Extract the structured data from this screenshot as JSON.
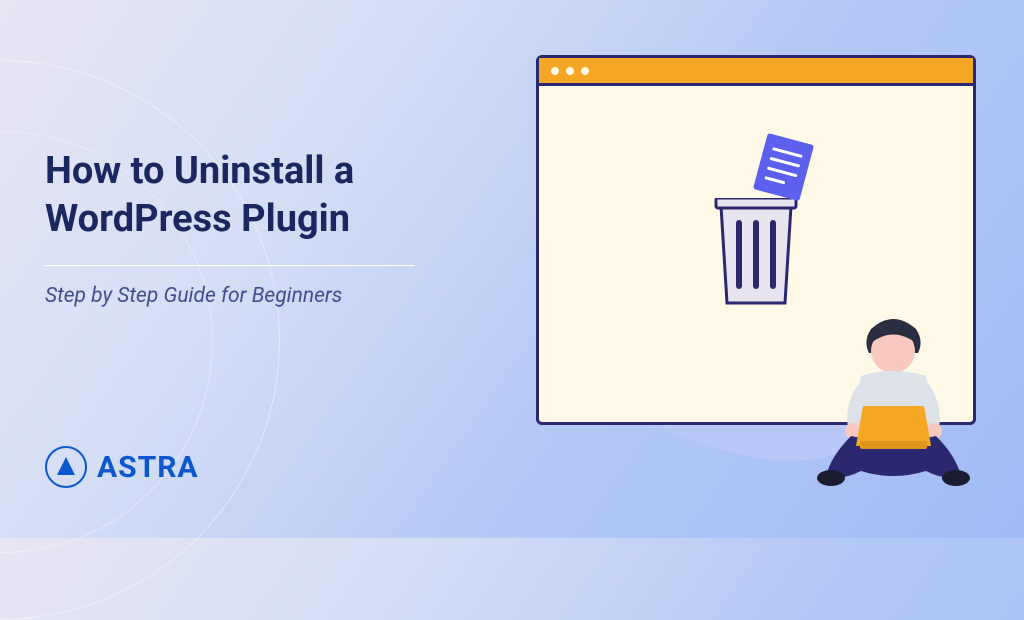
{
  "title": "How to Uninstall a WordPress Plugin",
  "subtitle": "Step by Step Guide for Beginners",
  "logo": {
    "text": "ASTRA",
    "icon": "astra-logo-icon"
  },
  "colors": {
    "title": "#1a2760",
    "subtitle": "#3f4f8f",
    "brand": "#0a57d0",
    "accent_orange": "#f5a623",
    "accent_purple": "#5d5fef",
    "window_border": "#2b2870",
    "window_bg": "#fff9e8"
  },
  "illustration": {
    "browser_dots": 3,
    "trash_icon": "trash-bin-icon",
    "document_icon": "document-icon",
    "person_icon": "person-with-laptop-icon"
  }
}
